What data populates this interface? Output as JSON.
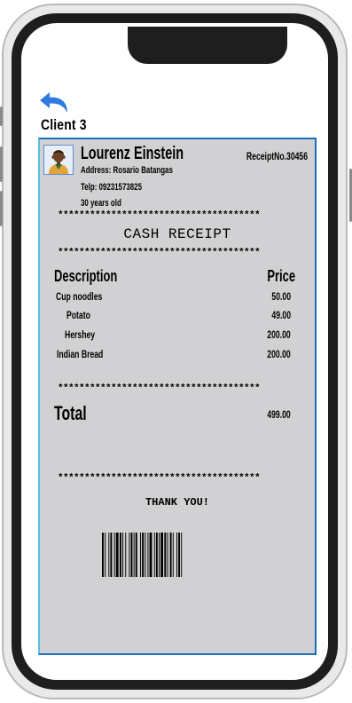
{
  "app": {
    "client_title": "Client 3"
  },
  "customer": {
    "name": "Lourenz Einstein",
    "address": "Address: Rosario Batangas",
    "telephone": "Telp: 09231573825",
    "age": "30 years old"
  },
  "receipt": {
    "number": "ReceiptNo.30456",
    "separator": "**************************************",
    "heading": "CASH RECEIPT",
    "columns": {
      "description": "Description",
      "price": "Price"
    },
    "items": [
      {
        "name": "Cup noodles",
        "price": "50.00"
      },
      {
        "name": "Potato",
        "price": "49.00"
      },
      {
        "name": "Hershey",
        "price": "200.00"
      },
      {
        "name": "Indian Bread",
        "price": "200.00"
      }
    ],
    "total_label": "Total",
    "total_value": "499.00",
    "thank_you": "THANK YOU!"
  },
  "icons": {
    "back": "back-arrow-icon",
    "avatar": "user-avatar-icon",
    "barcode": "barcode-icon"
  },
  "colors": {
    "accent_blue": "#2f7be0",
    "receipt_bg": "#d1d1d3",
    "border_blue": "#1a6fbd"
  }
}
